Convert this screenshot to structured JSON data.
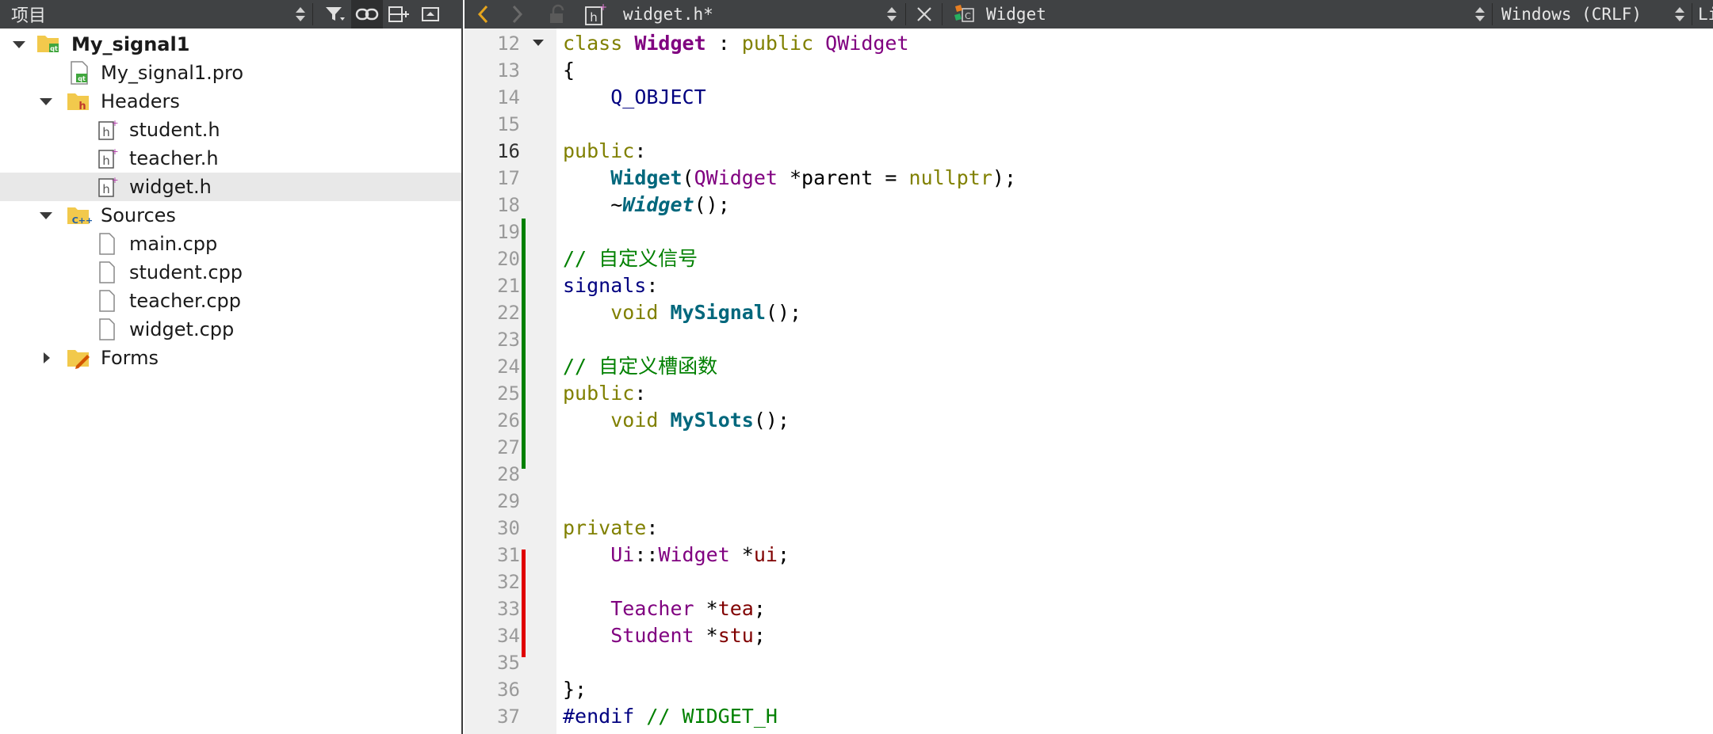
{
  "project_panel": {
    "title": "项目",
    "tree": [
      {
        "label": "My_signal1",
        "icon": "qt-project-folder-icon",
        "expanded": true,
        "bold": true
      },
      {
        "label": "My_signal1.pro",
        "icon": "qt-pro-file-icon"
      },
      {
        "label": "Headers",
        "icon": "header-folder-icon",
        "expanded": true
      },
      {
        "label": "student.h",
        "icon": "header-file-icon"
      },
      {
        "label": "teacher.h",
        "icon": "header-file-icon"
      },
      {
        "label": "widget.h",
        "icon": "header-file-icon",
        "selected": true
      },
      {
        "label": "Sources",
        "icon": "cpp-folder-icon",
        "expanded": true
      },
      {
        "label": "main.cpp",
        "icon": "file-icon"
      },
      {
        "label": "student.cpp",
        "icon": "file-icon"
      },
      {
        "label": "teacher.cpp",
        "icon": "file-icon"
      },
      {
        "label": "widget.cpp",
        "icon": "file-icon"
      },
      {
        "label": "Forms",
        "icon": "forms-folder-icon",
        "expanded": false
      }
    ]
  },
  "editor": {
    "file_name": "widget.h*",
    "symbol": "Widget",
    "line_ending": "Windows (CRLF)",
    "cursor_label": "Li",
    "current_line": "16",
    "line_numbers": [
      "12",
      "13",
      "14",
      "15",
      "16",
      "17",
      "18",
      "19",
      "20",
      "21",
      "22",
      "23",
      "24",
      "25",
      "26",
      "27",
      "28",
      "29",
      "30",
      "31",
      "32",
      "33",
      "34",
      "35",
      "36",
      "37"
    ],
    "tokens": {
      "l12_class": "class",
      "l12_name": "Widget",
      "l12_colon": " : ",
      "l12_public": "public",
      "l12_base": "QWidget",
      "l13": "{",
      "l14": "Q_OBJECT",
      "l16_public": "public",
      "l16_colon": ":",
      "l17_ctor": "Widget",
      "l17_open": "(",
      "l17_type": "QWidget",
      "l17_rest": " *parent = ",
      "l17_null": "nullptr",
      "l17_end": ");",
      "l18_tilde": "~",
      "l18_dtor": "Widget",
      "l18_end": "();",
      "l20": "// 自定义信号",
      "l21_signals": "signals",
      "l21_colon": ":",
      "l22_void": "void",
      "l22_fn": "MySignal",
      "l22_end": "();",
      "l24": "// 自定义槽函数",
      "l25_public": "public",
      "l25_colon": ":",
      "l26_void": "void",
      "l26_fn": "MySlots",
      "l26_end": "();",
      "l29_private": "private",
      "l29_colon": ":",
      "l30_ns": "Ui",
      "l30_sep": "::",
      "l30_type": "Widget",
      "l30_star": " *",
      "l30_var": "ui",
      "l30_end": ";",
      "l32_type": "Teacher",
      "l32_star": " *",
      "l32_var": "tea",
      "l32_end": ";",
      "l33_type": "Student",
      "l33_star": " *",
      "l33_var": "stu",
      "l33_end": ";",
      "l35": "};",
      "l36_pp": "#endif",
      "l36_cm": " // WIDGET_H"
    }
  },
  "colors": {
    "toolbar_bg": "#404244",
    "added_bar": "#008000",
    "modified_bar": "#e00000",
    "selection": "#e8e8e8"
  }
}
